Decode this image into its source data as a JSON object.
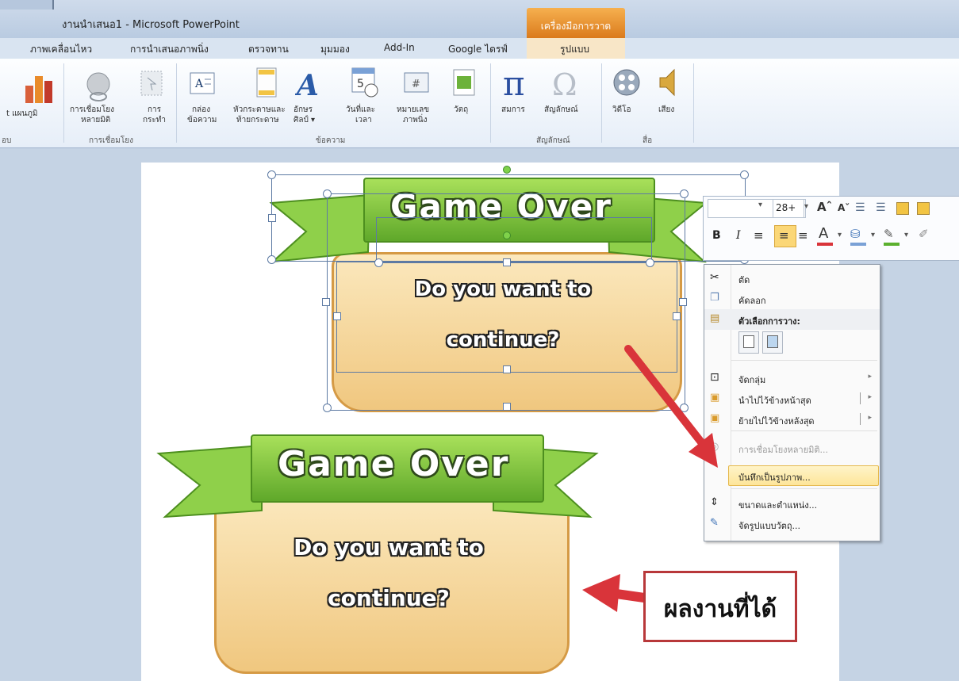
{
  "window": {
    "title": "งานนำเสนอ1 - Microsoft PowerPoint",
    "context_tab_group": "เครื่องมือการวาด"
  },
  "tabs": [
    "ภาพเคลื่อนไหว",
    "การนำเสนอภาพนิ่ง",
    "ตรวจทาน",
    "มุมมอง",
    "Add-In",
    "Google ไดรฟ์",
    "รูปแบบ"
  ],
  "ribbon": {
    "chart_label": "t แผนภูมิ",
    "hyperlink_label_1": "การเชื่อมโยง",
    "hyperlink_label_2": "หลายมิติ",
    "action_label_1": "การ",
    "action_label_2": "กระทำ",
    "textbox_label_1": "กล่อง",
    "textbox_label_2": "ข้อความ",
    "header_label_1": "หัวกระดาษและ",
    "header_label_2": "ท้ายกระดาษ",
    "wordart_label_1": "อักษร",
    "wordart_label_2": "ศิลป์ ▾",
    "datetime_label_1": "วันที่และ",
    "datetime_label_2": "เวลา",
    "slidenum_label_1": "หมายเลข",
    "slidenum_label_2": "ภาพนิ่ง",
    "object_label": "วัตถุ",
    "equation_label": "สมการ",
    "symbol_label": "สัญลักษณ์",
    "video_label": "วิดีโอ",
    "audio_label": "เสียง",
    "group_left": "อบ",
    "group_links": "การเชื่อมโยง",
    "group_text": "ข้อความ",
    "group_symbols": "สัญลักษณ์",
    "group_media": "สื่อ"
  },
  "slide": {
    "banner_text": "Game Over",
    "question_line1": "Do you want to",
    "question_line2": "continue?"
  },
  "mini_toolbar": {
    "font_size": "28+",
    "bold": "B",
    "italic": "I"
  },
  "context_menu": {
    "items": [
      {
        "label": "ตัด",
        "icon": "scissors-icon",
        "enabled": true
      },
      {
        "label": "คัดลอก",
        "icon": "copy-icon",
        "enabled": true
      },
      {
        "label": "ตัวเลือกการวาง:",
        "icon": "paste-icon",
        "enabled": true
      },
      {
        "label": "จัดกลุ่ม",
        "icon": "group-icon",
        "enabled": true
      },
      {
        "label": "นำไปไว้ข้างหน้าสุด",
        "icon": "bring-front-icon",
        "enabled": true
      },
      {
        "label": "ย้ายไปไว้ข้างหลังสุด",
        "icon": "send-back-icon",
        "enabled": true
      },
      {
        "label": "การเชื่อมโยงหลายมิติ...",
        "icon": "hyperlink-icon",
        "enabled": false
      },
      {
        "label": "บันทึกเป็นรูปภาพ...",
        "icon": "",
        "enabled": true
      },
      {
        "label": "ขนาดและตำแหน่ง...",
        "icon": "size-icon",
        "enabled": true
      },
      {
        "label": "จัดรูปแบบวัตถุ...",
        "icon": "format-icon",
        "enabled": true
      }
    ]
  },
  "callout": {
    "text": "ผลงานที่ได้"
  },
  "colors": {
    "accent_red": "#d9343a",
    "banner_green": "#6cb935",
    "card_tan": "#f3d08e",
    "context_orange": "#e98c25"
  }
}
